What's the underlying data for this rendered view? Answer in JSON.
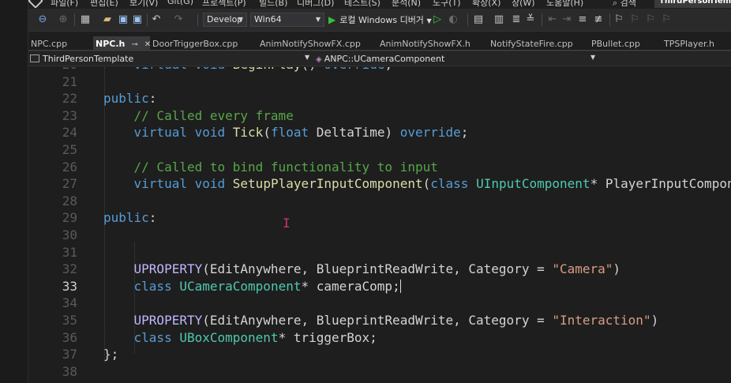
{
  "menu": {
    "items": [
      "파일(F)",
      "편집(E)",
      "보기(V)",
      "Git(G)",
      "프로젝트(P)",
      "빌드(B)",
      "디버그(D)",
      "테스트(S)",
      "분석(N)",
      "도구(T)",
      "확장(X)",
      "창(W)",
      "도움말(H)"
    ],
    "search": "검색",
    "project": "ThirdPersonTemplate"
  },
  "toolbar": {
    "config": "Develop",
    "platform": "Win64",
    "run_label": "로컬 Windows 디버거"
  },
  "tabs": [
    {
      "label": "NPC.cpp",
      "active": false
    },
    {
      "label": "NPC.h",
      "active": true
    },
    {
      "label": "DoorTriggerBox.cpp",
      "active": false
    },
    {
      "label": "AnimNotifyShowFX.cpp",
      "active": false
    },
    {
      "label": "AnimNotifyShowFX.h",
      "active": false
    },
    {
      "label": "NotifyStateFire.cpp",
      "active": false
    },
    {
      "label": "PBullet.cpp",
      "active": false
    },
    {
      "label": "TPSPlayer.h",
      "active": false
    }
  ],
  "navbar": {
    "project": "ThirdPersonTemplate",
    "member": "ANPC::UCameraComponent"
  },
  "editor": {
    "current_line": "33",
    "lines": [
      {
        "n": "20",
        "tokens": [
          {
            "t": "    "
          },
          {
            "t": "virtual",
            "c": "kw"
          },
          {
            "t": " "
          },
          {
            "t": "void",
            "c": "kw"
          },
          {
            "t": " "
          },
          {
            "t": "BeginPlay",
            "c": "fn"
          },
          {
            "t": "() "
          },
          {
            "t": "override",
            "c": "kw"
          },
          {
            "t": ";"
          }
        ]
      },
      {
        "n": "21",
        "tokens": []
      },
      {
        "n": "22",
        "tokens": [
          {
            "t": "public",
            "c": "kw"
          },
          {
            "t": ":"
          }
        ]
      },
      {
        "n": "23",
        "tokens": [
          {
            "t": "    "
          },
          {
            "t": "// Called every frame",
            "c": "cm"
          }
        ]
      },
      {
        "n": "24",
        "tokens": [
          {
            "t": "    "
          },
          {
            "t": "virtual",
            "c": "kw"
          },
          {
            "t": " "
          },
          {
            "t": "void",
            "c": "kw"
          },
          {
            "t": " "
          },
          {
            "t": "Tick",
            "c": "fn"
          },
          {
            "t": "("
          },
          {
            "t": "float",
            "c": "kw"
          },
          {
            "t": " DeltaTime) "
          },
          {
            "t": "override",
            "c": "kw"
          },
          {
            "t": ";"
          }
        ]
      },
      {
        "n": "25",
        "tokens": []
      },
      {
        "n": "26",
        "tokens": [
          {
            "t": "    "
          },
          {
            "t": "// Called to bind functionality to input",
            "c": "cm"
          }
        ]
      },
      {
        "n": "27",
        "tokens": [
          {
            "t": "    "
          },
          {
            "t": "virtual",
            "c": "kw"
          },
          {
            "t": " "
          },
          {
            "t": "void",
            "c": "kw"
          },
          {
            "t": " "
          },
          {
            "t": "SetupPlayerInputComponent",
            "c": "fn"
          },
          {
            "t": "("
          },
          {
            "t": "class",
            "c": "kw"
          },
          {
            "t": " "
          },
          {
            "t": "UInputComponent",
            "c": "ty"
          },
          {
            "t": "* PlayerInputCompone"
          }
        ]
      },
      {
        "n": "28",
        "tokens": []
      },
      {
        "n": "29",
        "tokens": [
          {
            "t": "public",
            "c": "kw"
          },
          {
            "t": ":"
          }
        ]
      },
      {
        "n": "30",
        "tokens": []
      },
      {
        "n": "31",
        "tokens": []
      },
      {
        "n": "32",
        "tokens": [
          {
            "t": "    "
          },
          {
            "t": "UPROPERTY",
            "c": "mac"
          },
          {
            "t": "(EditAnywhere, BlueprintReadWrite, Category = "
          },
          {
            "t": "\"Camera\"",
            "c": "st"
          },
          {
            "t": ")"
          }
        ]
      },
      {
        "n": "33",
        "tokens": [
          {
            "t": "    "
          },
          {
            "t": "class",
            "c": "kw"
          },
          {
            "t": " "
          },
          {
            "t": "UCameraComponent",
            "c": "ty"
          },
          {
            "t": "* cameraComp;"
          }
        ],
        "caret": true
      },
      {
        "n": "34",
        "tokens": []
      },
      {
        "n": "35",
        "tokens": [
          {
            "t": "    "
          },
          {
            "t": "UPROPERTY",
            "c": "mac"
          },
          {
            "t": "(EditAnywhere, BlueprintReadWrite, Category = "
          },
          {
            "t": "\"Interaction\"",
            "c": "st"
          },
          {
            "t": ")"
          }
        ]
      },
      {
        "n": "36",
        "tokens": [
          {
            "t": "    "
          },
          {
            "t": "class",
            "c": "kw"
          },
          {
            "t": " "
          },
          {
            "t": "UBoxComponent",
            "c": "ty"
          },
          {
            "t": "* triggerBox;"
          }
        ]
      },
      {
        "n": "37",
        "tokens": [
          {
            "t": "};"
          }
        ]
      },
      {
        "n": "38",
        "tokens": []
      }
    ]
  }
}
